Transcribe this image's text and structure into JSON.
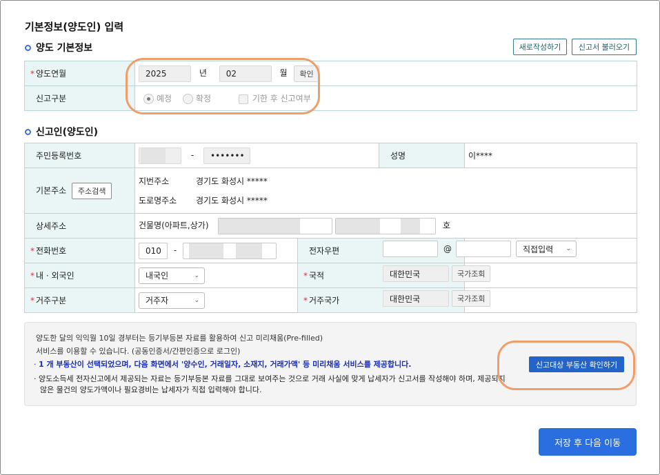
{
  "page_title": "기본정보(양도인) 입력",
  "sections": {
    "transfer": "양도 기본정보",
    "reporter": "신고인(양도인)"
  },
  "toolbar": {
    "new_label": "새로작성하기",
    "load_label": "신고서 불러오기"
  },
  "transfer": {
    "year_month_label": "양도연월",
    "year": "2025",
    "year_unit": "년",
    "month": "02",
    "month_unit": "월",
    "confirm": "확인",
    "report_type_label": "신고구분",
    "opt_planned": "예정",
    "opt_final": "확정",
    "late_report": "기한 후 신고여부"
  },
  "reporter": {
    "rrn_label": "주민등록번호",
    "rrn_dash": "-",
    "rrn_back": "•••••••",
    "name_label": "성명",
    "name_value": "이****",
    "addr_label": "기본주소",
    "addr_search": "주소검색",
    "lot_addr_label": "지번주소",
    "lot_addr_value": "경기도 화성시 *****",
    "road_addr_label": "도로명주소",
    "road_addr_value": "경기도 화성시 *****",
    "detail_label": "상세주소",
    "building_label": "건물명(아파트,상가)",
    "ho_unit": "호",
    "phone_label": "전화번호",
    "phone_prefix": "010",
    "phone_dash": "-",
    "email_label": "전자우편",
    "email_at": "@",
    "email_domain_select": "직접입력",
    "nationality_type_label": "내 · 외국인",
    "nationality_type_value": "내국인",
    "country_label": "국적",
    "country_value": "대한민국",
    "country_search": "국가조회",
    "residence_label": "거주구분",
    "residence_value": "거주자",
    "residence_country_label": "거주국가",
    "residence_country_value": "대한민국",
    "residence_country_search": "국가조회"
  },
  "info": {
    "line1": "양도한 달의 익익월 10일 경부터는 등기부등본 자료를 활용하여 신고 미리채움(Pre-filled)",
    "line2": "서비스를 이용할 수 있습니다. (공동인증서/간편인증으로 로그인)",
    "bullet1": "1 개 부동산이 선택되었으며, 다음 화면에서 '양수인, 거래일자, 소재지, 거래가액' 등 미리채움 서비스를 제공합니다.",
    "bullet2a": "양도소득세 전자신고에서 제공되는 자료는 등기부등본 자료를 그대로 보여주는 것으로 거래 사실에 맞게 납세자가 신고서를 작성해야 하며, 제공되지",
    "bullet2b": "않은 물건의 양도가액이나 필요경비는 납세자가 직접 입력해야 합니다.",
    "confirm_button": "신고대상 부동산 확인하기"
  },
  "save_button": "저장 후 다음 이동",
  "colors": {
    "label_bg": "#eaf5f5",
    "border": "#b8d4d4",
    "primary": "#2b6ee0",
    "required": "#d9323a",
    "highlight_oval": "#ef9d6a"
  }
}
